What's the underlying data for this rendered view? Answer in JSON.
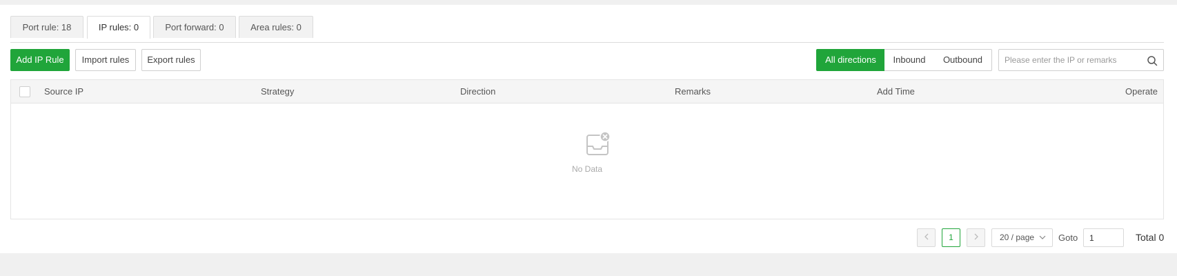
{
  "tabs": [
    {
      "label": "Port rule: 18",
      "active": false
    },
    {
      "label": "IP rules: 0",
      "active": true
    },
    {
      "label": "Port forward: 0",
      "active": false
    },
    {
      "label": "Area rules: 0",
      "active": false
    }
  ],
  "toolbar": {
    "add_label": "Add IP Rule",
    "import_label": "Import rules",
    "export_label": "Export rules"
  },
  "direction_filter": {
    "options": [
      "All directions",
      "Inbound",
      "Outbound"
    ],
    "selected": "All directions"
  },
  "search": {
    "placeholder": "Please enter the IP or remarks",
    "value": "",
    "icon": "search-icon"
  },
  "table": {
    "columns": [
      "Source IP",
      "Strategy",
      "Direction",
      "Remarks",
      "Add Time",
      "Operate"
    ],
    "rows": [],
    "empty_text": "No Data",
    "empty_icon": "empty-inbox-icon"
  },
  "pagination": {
    "current_page": "1",
    "page_size_label": "20 / page",
    "goto_label": "Goto",
    "goto_value": "1",
    "total_label": "Total 0"
  },
  "colors": {
    "accent": "#20a53a",
    "background": "#f0f0f0"
  }
}
